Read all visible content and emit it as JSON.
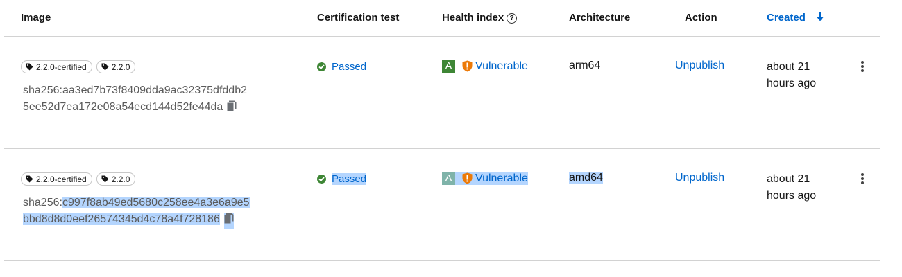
{
  "table": {
    "columns": {
      "image": "Image",
      "certification": "Certification test",
      "health": "Health index",
      "architecture": "Architecture",
      "action": "Action",
      "created": "Created"
    },
    "rows": [
      {
        "tags": [
          "2.2.0-certified",
          "2.2.0"
        ],
        "digest_prefix": "sha256:",
        "digest_hash": "aa3ed7b73f8409dda9ac32375dfddb25ee52d7ea172e08a54ecd144d52fe44da",
        "certification": "Passed",
        "grade": "A",
        "health": "Vulnerable",
        "architecture": "arm64",
        "action": "Unpublish",
        "created": "about 21 hours ago"
      },
      {
        "tags": [
          "2.2.0-certified",
          "2.2.0"
        ],
        "digest_prefix": "sha256:",
        "digest_hash": "c997f8ab49ed5680c258ee4a3e6a9e5bbd8d8d0eef26574345d4c78a4f728186",
        "certification": "Passed",
        "grade": "A",
        "health": "Vulnerable",
        "architecture": "amd64",
        "action": "Unpublish",
        "created": "about 21 hours ago"
      }
    ]
  },
  "colors": {
    "link": "#0066cc",
    "success": "#3e8635",
    "warning": "#ec7a08",
    "selection": "#b4d5fe"
  }
}
